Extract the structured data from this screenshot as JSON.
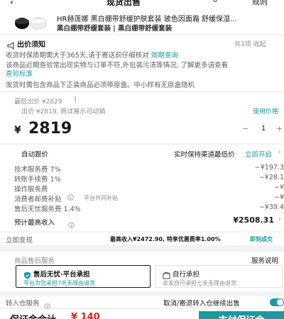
{
  "header": {
    "title": "现货出售",
    "rules": "规则"
  },
  "product": {
    "name": "HR赫莲娜 黑白绷带舒缓护肤套装 玻色因面霜 舒缓保湿...",
    "spec": "黑白绷带舒缓套装 | 黑白绷带舒缓套装"
  },
  "notice": {
    "title": "出价须知",
    "pager": "共3项 收起",
    "line1a": "收货时保质期需大于365天,请于寄送前仔细核对",
    "line1_link": "效期查询",
    "line2": "该商品近期查验常出现实物与订单不符,外包装污渍等情况, 了解更多请查看",
    "line2_link": "查验标准",
    "line3": "发货时需包含商品下正装商品必须带原盒。中小样有无原盒随机"
  },
  "pricing": {
    "lowest": "最低出价 ¥2829",
    "bid_hint": "出价 ¥2819, 商详展示可动销",
    "use_price_tool": "使用价格",
    "currency": "¥",
    "price": "2819",
    "qty": "1",
    "minus": "−",
    "plus": "+"
  },
  "auto_follow": {
    "label": "自动跟价",
    "right_text": "实时保持渠道最低价",
    "link": "立即开启"
  },
  "fees": [
    {
      "label": "技术服务费 7%",
      "note": "",
      "value": "−¥197.3"
    },
    {
      "label": "转账手续费 1%",
      "note": "",
      "value": "−¥28.1"
    },
    {
      "label": "操作服务费",
      "note": "",
      "value": "−¥"
    },
    {
      "label": "消费者邮费补贴",
      "note": "平台共同补贴",
      "value": "−¥"
    },
    {
      "label": "售后无忧服务费 1.4%",
      "note": "",
      "value": "−¥39.4"
    }
  ],
  "expected": {
    "label": "预计最高收入",
    "value": "¥2508.31"
  },
  "cashout": {
    "label": "立即变现",
    "text": "最高收入¥2472.90, 特享优惠费率1.00%",
    "link": "即刻成交"
  },
  "after_sales": {
    "title": "商品售后服务",
    "explain": "服务说明",
    "opt1_title": "售后无忧·平台承担",
    "opt1_desc": "平台为您承担7天无理由退货",
    "opt2_title": "自行承担",
    "opt2_desc": "卖家自行承担七天无理由退货"
  },
  "bottom": {
    "warehouse_label": "转入仓服务",
    "warehouse_right": "取消/寄退转入仓继续出售",
    "deposit_label": "保证金合计",
    "deposit_value": "¥ 140",
    "submit": "支付保证金"
  },
  "colors": {
    "teal": "#1a9aa0",
    "red": "#e2231a"
  }
}
